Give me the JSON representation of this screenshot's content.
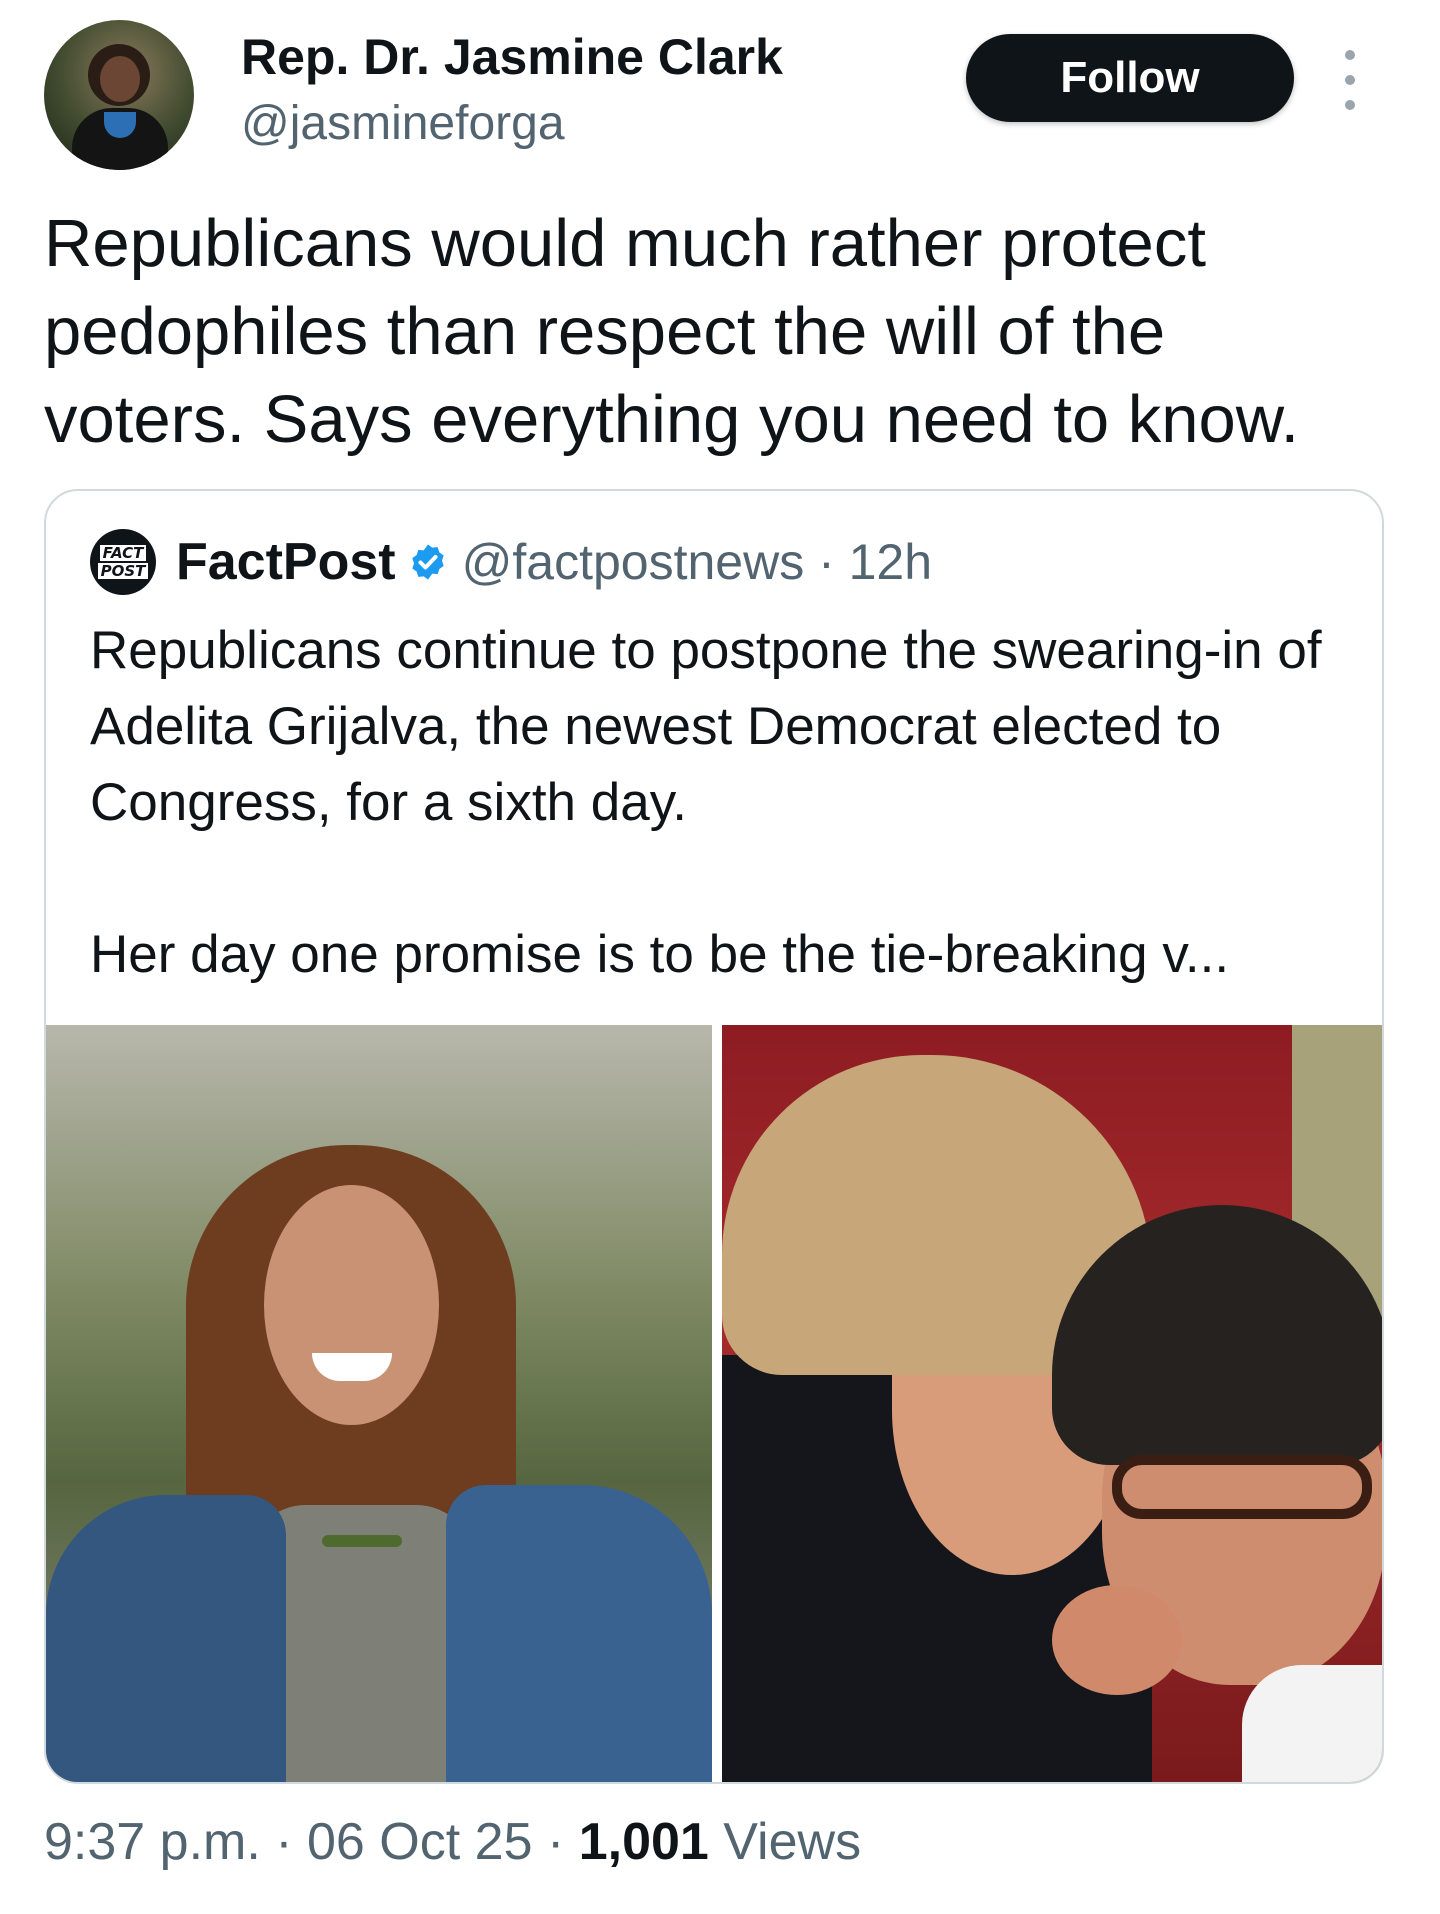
{
  "author": {
    "name": "Rep. Dr. Jasmine Clark",
    "handle": "@jasmineforga"
  },
  "follow_label": "Follow",
  "more_icon": "more-options-icon",
  "tweet_text": "Republicans would much rather protect pedophiles than respect the will of the voters. Says everything you need to know.",
  "quote": {
    "logo_top": "FACT",
    "logo_bottom": "POST",
    "name": "FactPost",
    "handle_time": "@factpostnews · 12h",
    "text": "Republicans continue to postpone the swearing-in of Adelita Grijalva, the newest Democrat elected to Congress, for a sixth day.\n\nHer day one promise is to be the tie-breaking v..."
  },
  "meta": {
    "time": "9:37 p.m.",
    "date": "06 Oct 25",
    "views_count": "1,001",
    "views_label": "Views"
  },
  "colors": {
    "primary_text": "#0f1419",
    "secondary_text": "#536471",
    "verified_blue": "#1d9bf0",
    "card_border": "#cfd9de"
  }
}
